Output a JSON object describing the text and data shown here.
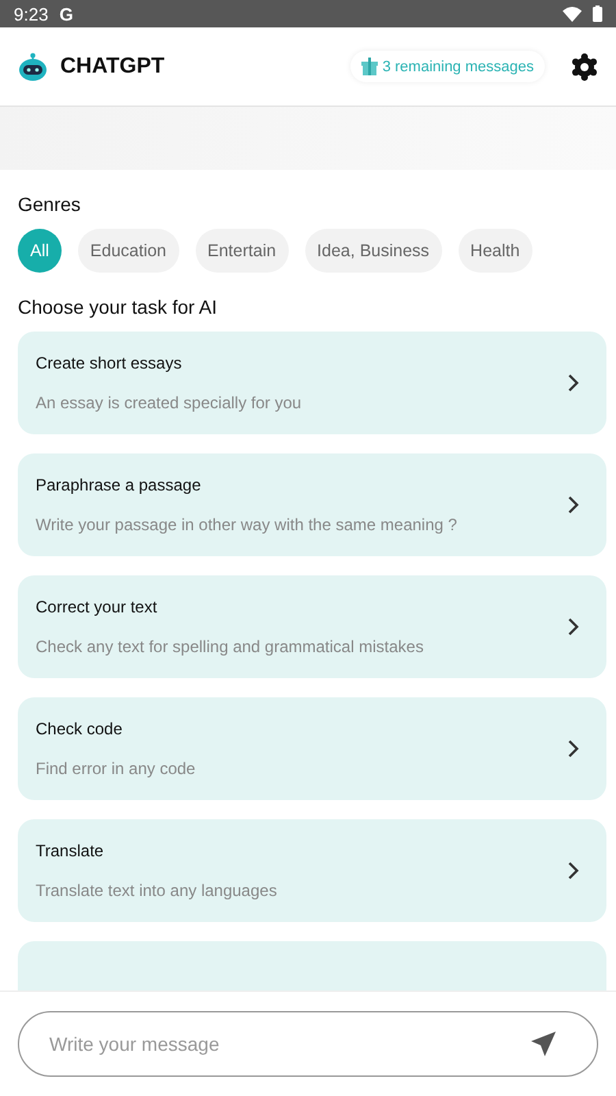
{
  "status_bar": {
    "time": "9:23",
    "notification": "G"
  },
  "header": {
    "title": "CHATGPT",
    "remaining": "3 remaining messages"
  },
  "genres": {
    "title": "Genres",
    "items": [
      {
        "label": "All",
        "selected": true
      },
      {
        "label": "Education",
        "selected": false
      },
      {
        "label": "Entertain",
        "selected": false
      },
      {
        "label": "Idea, Business",
        "selected": false
      },
      {
        "label": "Health",
        "selected": false
      }
    ]
  },
  "tasks": {
    "title": "Choose your task for AI",
    "items": [
      {
        "title": "Create short essays",
        "subtitle": "An essay is created specially for you"
      },
      {
        "title": "Paraphrase a passage",
        "subtitle": "Write your passage in other way with the same meaning ?"
      },
      {
        "title": "Correct your text",
        "subtitle": "Check any text for spelling and grammatical mistakes"
      },
      {
        "title": "Check code",
        "subtitle": "Find error in any code"
      },
      {
        "title": "Translate",
        "subtitle": "Translate text into any languages"
      }
    ]
  },
  "composer": {
    "placeholder": "Write your message"
  }
}
